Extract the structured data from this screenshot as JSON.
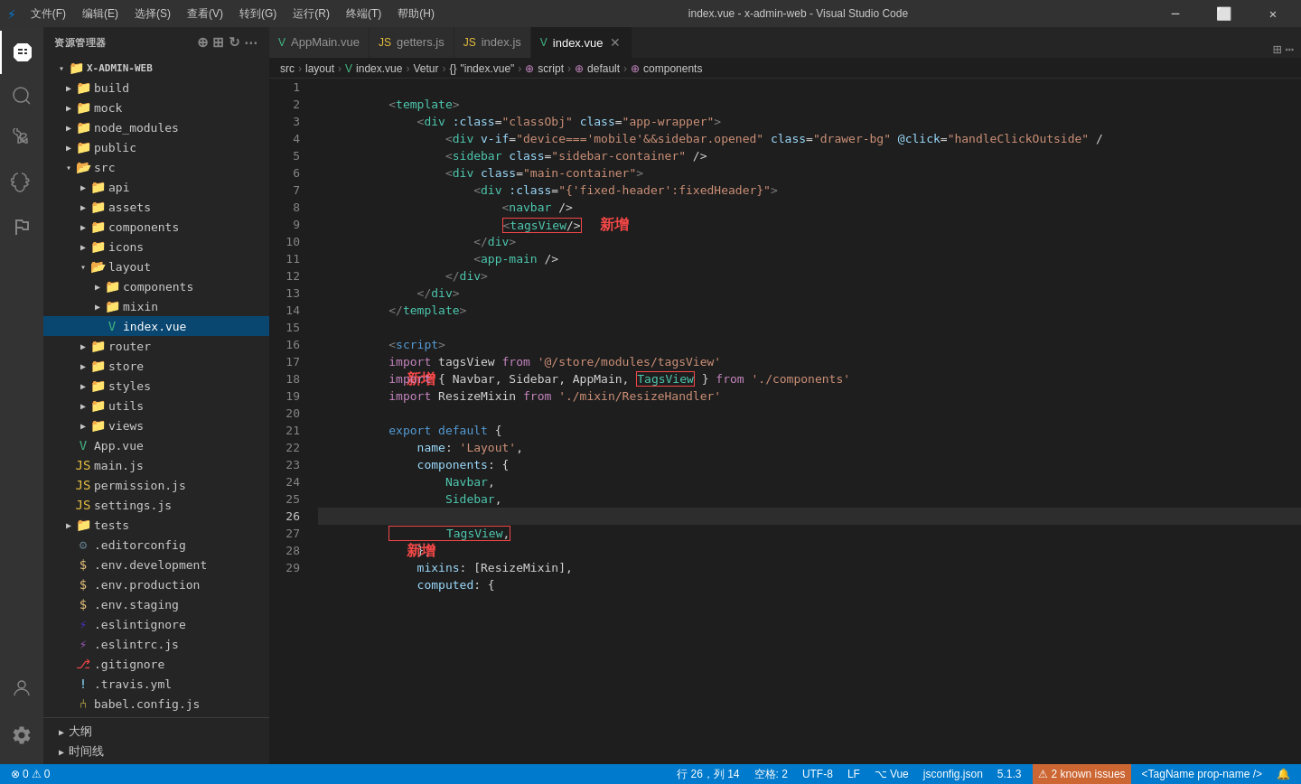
{
  "titleBar": {
    "icon": "⚡",
    "menus": [
      "文件(F)",
      "编辑(E)",
      "选择(S)",
      "查看(V)",
      "转到(G)",
      "运行(R)",
      "终端(T)",
      "帮助(H)"
    ],
    "title": "index.vue - x-admin-web - Visual Studio Code",
    "controls": [
      "⎘",
      "⊡",
      "❐",
      "×"
    ]
  },
  "tabs": [
    {
      "id": "appMain",
      "icon": "vue",
      "label": "AppMain.vue",
      "active": false,
      "modified": false
    },
    {
      "id": "getters",
      "icon": "js",
      "label": "getters.js",
      "active": false,
      "modified": false
    },
    {
      "id": "indexJs",
      "icon": "js",
      "label": "index.js",
      "active": false,
      "modified": false
    },
    {
      "id": "indexVue",
      "icon": "vue",
      "label": "index.vue",
      "active": true,
      "modified": false
    }
  ],
  "breadcrumb": [
    "src",
    ">",
    "layout",
    ">",
    "index.vue",
    ">",
    "Vetur",
    ">",
    "{}",
    "\"index.vue\"",
    ">",
    "⊕",
    "script",
    ">",
    "⊕",
    "default",
    ">",
    "⊕",
    "components"
  ],
  "sidebar": {
    "title": "资源管理器",
    "rootLabel": "X-ADMIN-WEB",
    "tree": [
      {
        "indent": 1,
        "type": "folder",
        "label": "build",
        "open": false
      },
      {
        "indent": 1,
        "type": "folder",
        "label": "mock",
        "open": false
      },
      {
        "indent": 1,
        "type": "folder",
        "label": "node_modules",
        "open": false
      },
      {
        "indent": 1,
        "type": "folder",
        "label": "public",
        "open": false
      },
      {
        "indent": 1,
        "type": "folder-open",
        "label": "src",
        "open": true
      },
      {
        "indent": 2,
        "type": "folder",
        "label": "api",
        "open": false
      },
      {
        "indent": 2,
        "type": "folder",
        "label": "assets",
        "open": false
      },
      {
        "indent": 2,
        "type": "folder",
        "label": "components",
        "open": false
      },
      {
        "indent": 2,
        "type": "folder",
        "label": "icons",
        "open": false
      },
      {
        "indent": 2,
        "type": "folder-open",
        "label": "layout",
        "open": true
      },
      {
        "indent": 3,
        "type": "folder",
        "label": "components",
        "open": false
      },
      {
        "indent": 3,
        "type": "folder",
        "label": "mixin",
        "open": false
      },
      {
        "indent": 3,
        "type": "vue",
        "label": "index.vue",
        "active": true
      },
      {
        "indent": 2,
        "type": "folder",
        "label": "router",
        "open": false
      },
      {
        "indent": 2,
        "type": "folder",
        "label": "store",
        "open": false
      },
      {
        "indent": 2,
        "type": "folder",
        "label": "styles",
        "open": false
      },
      {
        "indent": 2,
        "type": "folder",
        "label": "utils",
        "open": false
      },
      {
        "indent": 2,
        "type": "folder",
        "label": "views",
        "open": false
      },
      {
        "indent": 1,
        "type": "vue",
        "label": "App.vue"
      },
      {
        "indent": 1,
        "type": "js",
        "label": "main.js"
      },
      {
        "indent": 1,
        "type": "js",
        "label": "permission.js"
      },
      {
        "indent": 1,
        "type": "js",
        "label": "settings.js"
      },
      {
        "indent": 1,
        "type": "folder",
        "label": "tests",
        "open": false
      },
      {
        "indent": 1,
        "type": "config",
        "label": ".editorconfig"
      },
      {
        "indent": 1,
        "type": "env",
        "label": ".env.development"
      },
      {
        "indent": 1,
        "type": "env",
        "label": ".env.production"
      },
      {
        "indent": 1,
        "type": "env",
        "label": ".env.staging"
      },
      {
        "indent": 1,
        "type": "eslint",
        "label": ".eslintignore"
      },
      {
        "indent": 1,
        "type": "eslint2",
        "label": ".eslintrc.js"
      },
      {
        "indent": 1,
        "type": "git",
        "label": ".gitignore"
      },
      {
        "indent": 1,
        "type": "yaml",
        "label": ".travis.yml"
      },
      {
        "indent": 1,
        "type": "js2",
        "label": "babel.config.js"
      }
    ]
  },
  "statusBar": {
    "left": [
      {
        "icon": "⎇",
        "text": "大纲"
      },
      {
        "icon": "⏰",
        "text": "时间线"
      }
    ],
    "position": "行 26，列 14",
    "spaces": "空格: 2",
    "encoding": "UTF-8",
    "lineEnding": "LF",
    "language": "Vue",
    "config": "jsconfig.json",
    "version": "5.1.3",
    "knownIssues": "2 known issues",
    "tagName": "<TagName prop-name />"
  },
  "annotations": {
    "xinzeng1": "新增",
    "xinzeng2": "新增",
    "xinzeng3": "新增"
  }
}
